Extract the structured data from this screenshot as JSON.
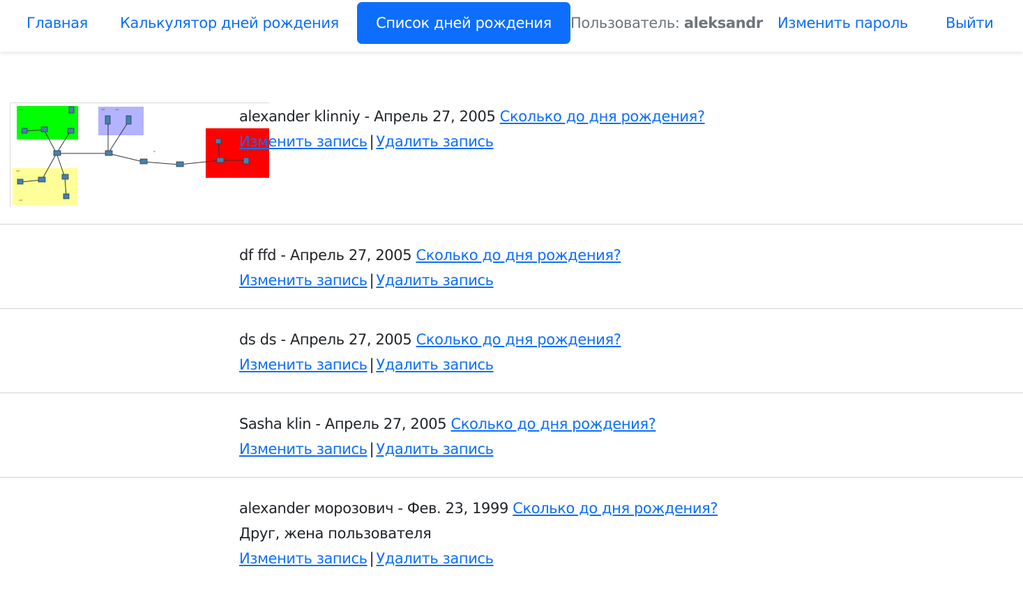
{
  "nav": {
    "home": "Главная",
    "calculator": "Калькулятор дней рождения",
    "list": "Список дней рождения",
    "user_prefix": "Пользователь:",
    "username": "aleksandr",
    "change_password": "Изменить пароль",
    "logout": "Выйти"
  },
  "links": {
    "how_long": "Сколько до дня рождения?",
    "edit": "Изменить запись",
    "delete": "Удалить запись",
    "separator": "|"
  },
  "entries": [
    {
      "name": "alexander klinniy",
      "date": "Апрель 27, 2005",
      "note": "",
      "has_image": true
    },
    {
      "name": "df ffd",
      "date": "Апрель 27, 2005",
      "note": ""
    },
    {
      "name": "ds ds",
      "date": "Апрель 27, 2005",
      "note": ""
    },
    {
      "name": "Sasha klin",
      "date": "Апрель 27, 2005",
      "note": ""
    },
    {
      "name": "alexander морозович",
      "date": "Фев. 23, 1999",
      "note": "Друг, жена пользователя"
    }
  ],
  "colors": {
    "primary": "#0d6efd",
    "muted": "#6c757d",
    "text": "#212529",
    "divider": "#cfd3d7",
    "diagram_green": "#00ff00",
    "diagram_purple": "#b3b3ff",
    "diagram_yellow": "#ffff99",
    "diagram_red": "#ff0000"
  }
}
